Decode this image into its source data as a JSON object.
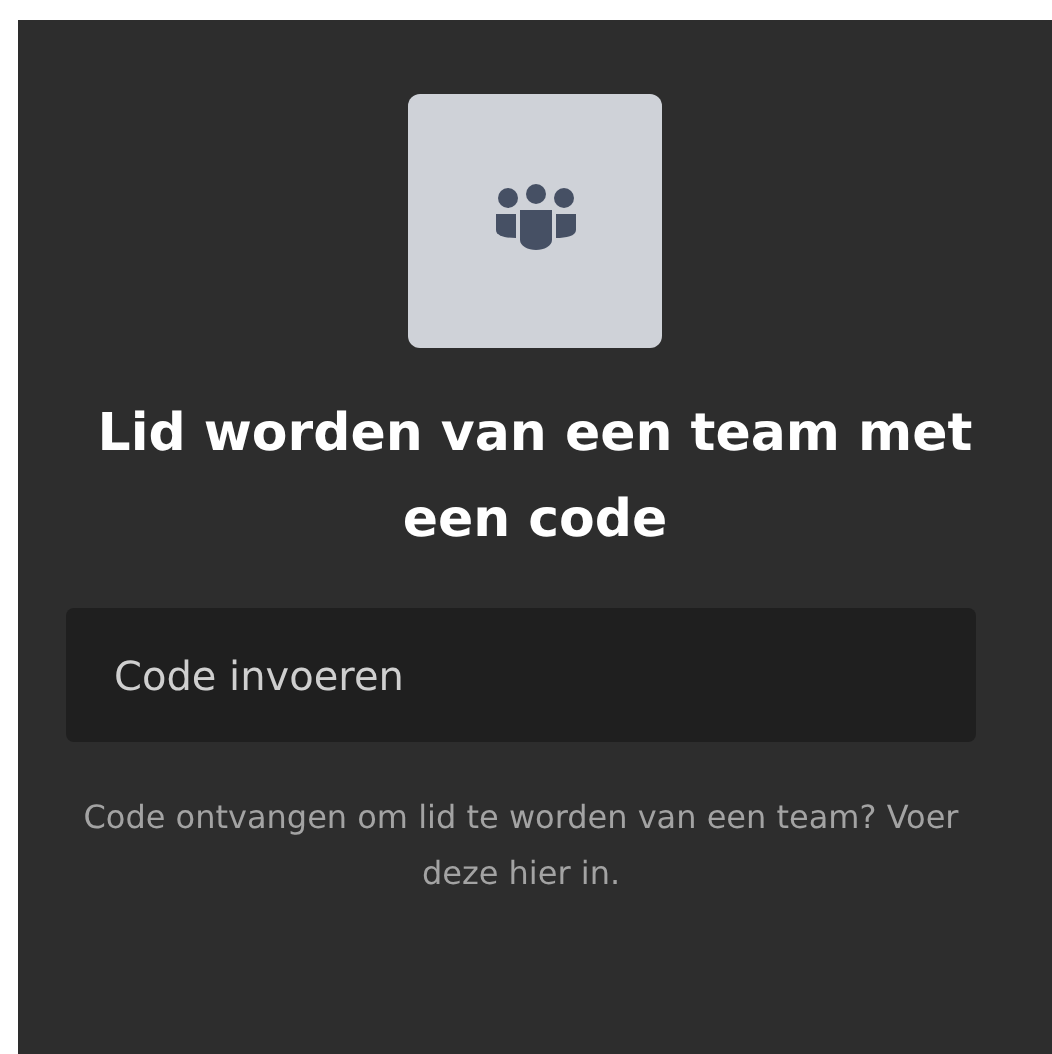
{
  "title": "Lid worden van een team met een code",
  "code_field": {
    "placeholder": "Code invoeren"
  },
  "hint": "Code ontvangen om lid te worden van een team? Voer deze hier in."
}
